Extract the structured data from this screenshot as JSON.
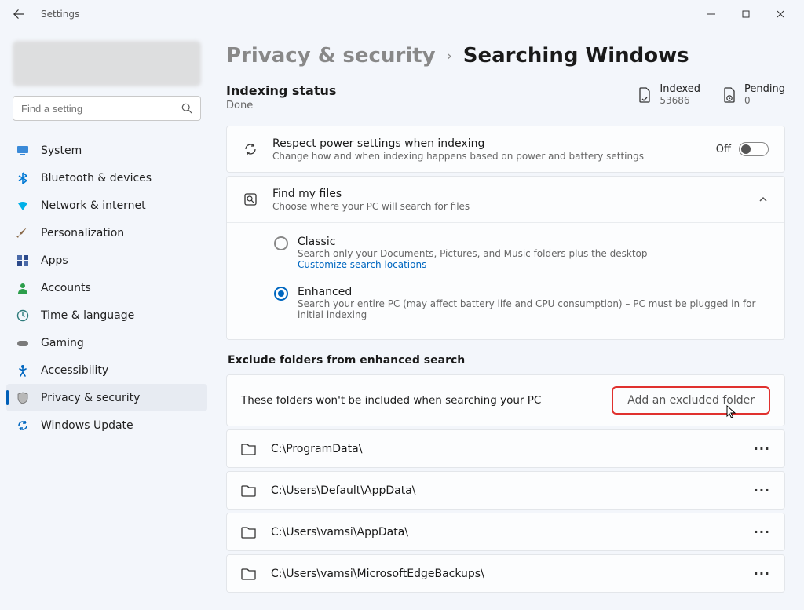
{
  "app": {
    "title": "Settings"
  },
  "search": {
    "placeholder": "Find a setting"
  },
  "sidebar": {
    "items": [
      {
        "label": "System",
        "icon": "monitor-icon",
        "color": "#0078d4"
      },
      {
        "label": "Bluetooth & devices",
        "icon": "bluetooth-icon",
        "color": "#0078d4"
      },
      {
        "label": "Network & internet",
        "icon": "wifi-icon",
        "color": "#0099e5"
      },
      {
        "label": "Personalization",
        "icon": "brush-icon",
        "color": "#886650"
      },
      {
        "label": "Apps",
        "icon": "apps-icon",
        "color": "#264a8b"
      },
      {
        "label": "Accounts",
        "icon": "person-icon",
        "color": "#2c9e4b"
      },
      {
        "label": "Time & language",
        "icon": "globe-clock-icon",
        "color": "#2c7a7a"
      },
      {
        "label": "Gaming",
        "icon": "gamepad-icon",
        "color": "#7a7a7a"
      },
      {
        "label": "Accessibility",
        "icon": "accessibility-icon",
        "color": "#0067c0"
      },
      {
        "label": "Privacy & security",
        "icon": "shield-icon",
        "color": "#6a6a6a",
        "active": true
      },
      {
        "label": "Windows Update",
        "icon": "update-icon",
        "color": "#0067c0"
      }
    ]
  },
  "breadcrumb": {
    "parent": "Privacy & security",
    "current": "Searching Windows"
  },
  "indexing": {
    "title": "Indexing status",
    "value": "Done",
    "stats": [
      {
        "label": "Indexed",
        "value": "53686"
      },
      {
        "label": "Pending",
        "value": "0"
      }
    ]
  },
  "power_row": {
    "title": "Respect power settings when indexing",
    "sub": "Change how and when indexing happens based on power and battery settings",
    "toggle_label": "Off"
  },
  "find_files": {
    "title": "Find my files",
    "sub": "Choose where your PC will search for files",
    "options": [
      {
        "title": "Classic",
        "sub": "Search only your Documents, Pictures, and Music folders plus the desktop",
        "link": "Customize search locations",
        "selected": false
      },
      {
        "title": "Enhanced",
        "sub": "Search your entire PC (may affect battery life and CPU consumption) – PC must be plugged in for initial indexing",
        "selected": true
      }
    ]
  },
  "exclude": {
    "section_label": "Exclude folders from enhanced search",
    "header_text": "These folders won't be included when searching your PC",
    "add_button": "Add an excluded folder",
    "folders": [
      "C:\\ProgramData\\",
      "C:\\Users\\Default\\AppData\\",
      "C:\\Users\\vamsi\\AppData\\",
      "C:\\Users\\vamsi\\MicrosoftEdgeBackups\\"
    ]
  }
}
